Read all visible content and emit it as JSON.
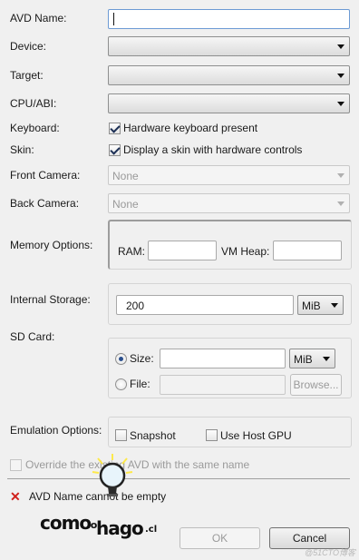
{
  "form": {
    "avd_name": {
      "label": "AVD Name:",
      "value": ""
    },
    "device": {
      "label": "Device:",
      "value": ""
    },
    "target": {
      "label": "Target:",
      "value": ""
    },
    "cpu_abi": {
      "label": "CPU/ABI:",
      "value": ""
    },
    "keyboard": {
      "label": "Keyboard:",
      "checkbox_label": "Hardware keyboard present",
      "checked": true
    },
    "skin": {
      "label": "Skin:",
      "checkbox_label": "Display a skin with hardware controls",
      "checked": true
    },
    "front_camera": {
      "label": "Front Camera:",
      "value": "None",
      "enabled": false
    },
    "back_camera": {
      "label": "Back Camera:",
      "value": "None",
      "enabled": false
    },
    "memory": {
      "label": "Memory Options:",
      "ram_label": "RAM:",
      "ram_value": "",
      "vm_heap_label": "VM Heap:",
      "vm_heap_value": ""
    },
    "internal_storage": {
      "label": "Internal Storage:",
      "value": "200",
      "unit": "MiB"
    },
    "sd_card": {
      "label": "SD Card:",
      "size_label": "Size:",
      "size_value": "",
      "size_unit": "MiB",
      "size_selected": true,
      "file_label": "File:",
      "file_value": "",
      "browse_label": "Browse..."
    },
    "emulation": {
      "label": "Emulation Options:",
      "snapshot_label": "Snapshot",
      "snapshot_checked": false,
      "host_gpu_label": "Use Host GPU",
      "host_gpu_checked": false
    },
    "override": {
      "label": "Override the existing AVD with the same name",
      "checked": false,
      "enabled": false
    }
  },
  "error": {
    "message": "AVD Name cannot be empty"
  },
  "buttons": {
    "ok": "OK",
    "cancel": "Cancel"
  },
  "logo": {
    "line1": "como",
    "line2": "lo",
    "line3": "hago",
    "suffix": ".cl"
  },
  "watermark": "@51CTO博客",
  "colors": {
    "error": "#d0201c",
    "focus_border": "#6c9ad4",
    "logo_bulb": "#f7e34a"
  }
}
